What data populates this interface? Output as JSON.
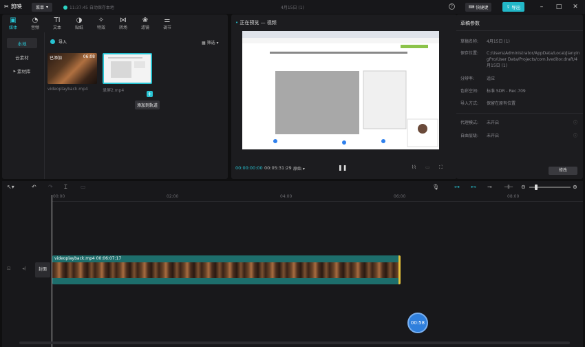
{
  "titlebar": {
    "logo": "剪映",
    "menu": "菜单",
    "autosave": "11:37:45 自动保存本地",
    "project_title": "4月15日 (1)",
    "shortcut": "快捷键",
    "export": "导出"
  },
  "tool_tabs": [
    {
      "label": "媒体",
      "icon": "media-icon"
    },
    {
      "label": "音频",
      "icon": "audio-icon"
    },
    {
      "label": "文本",
      "icon": "text-icon"
    },
    {
      "label": "贴纸",
      "icon": "sticker-icon"
    },
    {
      "label": "特效",
      "icon": "effects-icon"
    },
    {
      "label": "转场",
      "icon": "transition-icon"
    },
    {
      "label": "滤镜",
      "icon": "filter-icon"
    },
    {
      "label": "调节",
      "icon": "adjust-icon"
    }
  ],
  "side_nav": [
    "本地",
    "云素材",
    "素材库"
  ],
  "media": {
    "import": "导入",
    "sort": "筛选",
    "clips": [
      {
        "name": "videoplayback.mp4",
        "badge": "已添加",
        "duration": "06:08"
      },
      {
        "name": "录屏2.mp4",
        "badge": "",
        "duration": ""
      }
    ],
    "add_tooltip": "添加到轨道"
  },
  "preview": {
    "title": "正在预览 — 视频",
    "time_current": "00:00:00:00",
    "time_total": "00:05:31:29",
    "ratio": "原始"
  },
  "params": {
    "title": "草稿参数",
    "rows": [
      {
        "label": "草稿名称:",
        "value": "4月15日 (1)"
      },
      {
        "label": "保存位置:",
        "value": "C:/Users/Administrator/AppData/Local/JianyingPro/User Data/Projects/com.lveditor.draft/4月15日 (1)"
      },
      {
        "label": "分辨率:",
        "value": "适应"
      },
      {
        "label": "色彩空间:",
        "value": "标准 SDR - Rec.709"
      },
      {
        "label": "导入方式:",
        "value": "保留在原有位置"
      },
      {
        "label": "代理模式:",
        "value": "未开启"
      },
      {
        "label": "自由层级:",
        "value": "未开启"
      }
    ],
    "modify": "修改"
  },
  "timeline": {
    "ticks": [
      "00:00",
      "02:00",
      "04:00",
      "06:00",
      "08:00"
    ],
    "cover": "封面",
    "clip_label": "videoplayback.mp4   00:06:07:17",
    "bubble": "00:58"
  }
}
